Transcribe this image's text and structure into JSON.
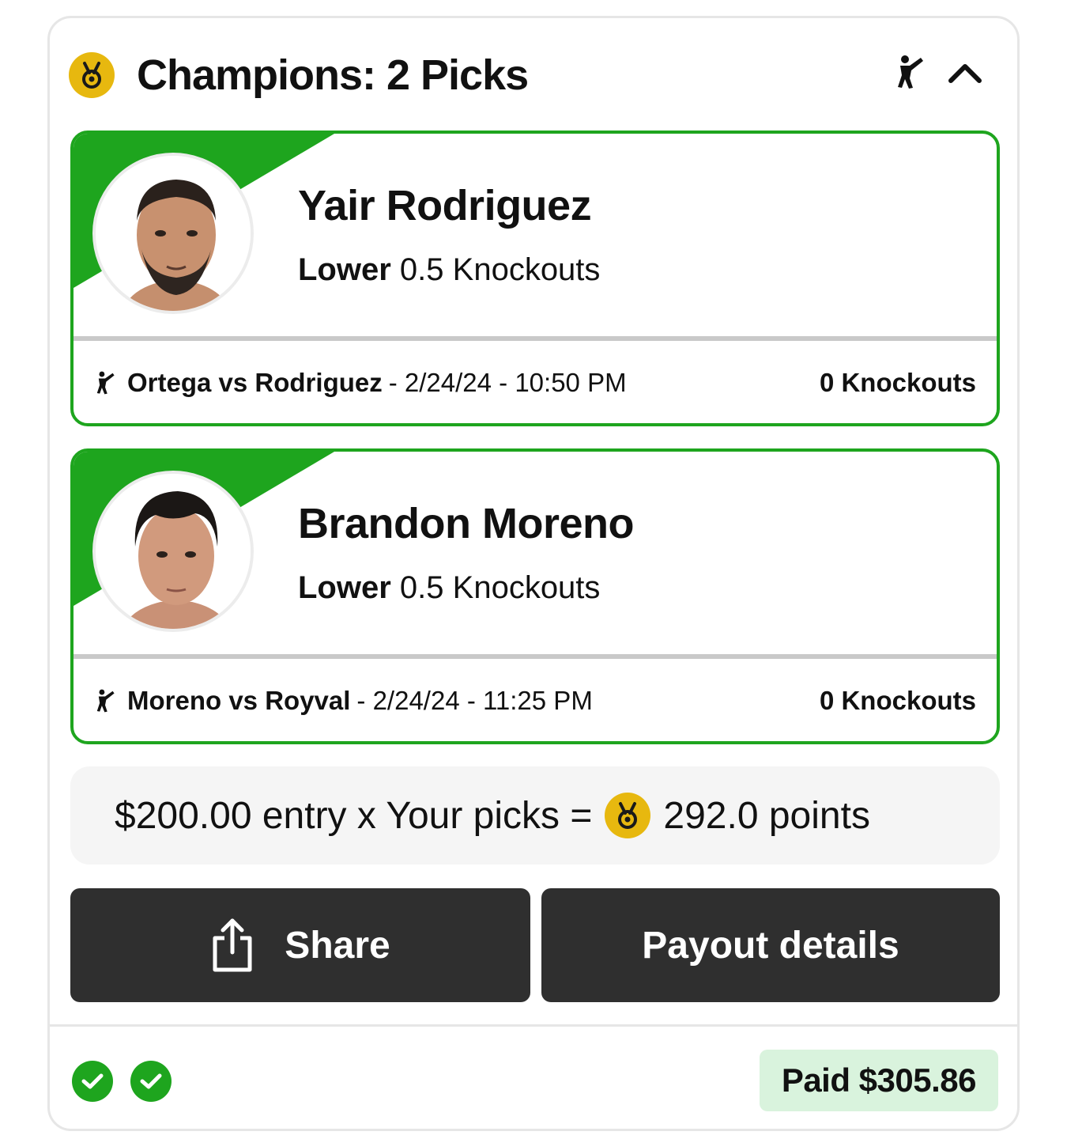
{
  "header": {
    "title": "Champions: 2 Picks",
    "medal_icon": "medal-icon",
    "sport_icon": "kick-fighter-icon",
    "collapse_icon": "chevron-up-icon"
  },
  "picks": [
    {
      "name": "Yair Rodriguez",
      "direction": "Lower",
      "line": "0.5 Knockouts",
      "match": "Ortega vs Rodriguez",
      "date": "- 2/24/24 - 10:50 PM",
      "result": "0 Knockouts",
      "avatar": "player-photo"
    },
    {
      "name": "Brandon Moreno",
      "direction": "Lower",
      "line": "0.5 Knockouts",
      "match": "Moreno vs Royval",
      "date": "- 2/24/24 - 11:25 PM",
      "result": "0 Knockouts",
      "avatar": "player-photo"
    }
  ],
  "summary": {
    "prefix": "$200.00 entry x Your picks =",
    "points": "292.0 points"
  },
  "buttons": {
    "share": "Share",
    "payout": "Payout details"
  },
  "status": {
    "paid": "Paid $305.86",
    "checks": 2
  },
  "colors": {
    "accent_green": "#1ea51e",
    "medal_gold": "#e7b80f",
    "button_dark": "#2f2f2f",
    "paid_bg": "#d9f3dd"
  }
}
